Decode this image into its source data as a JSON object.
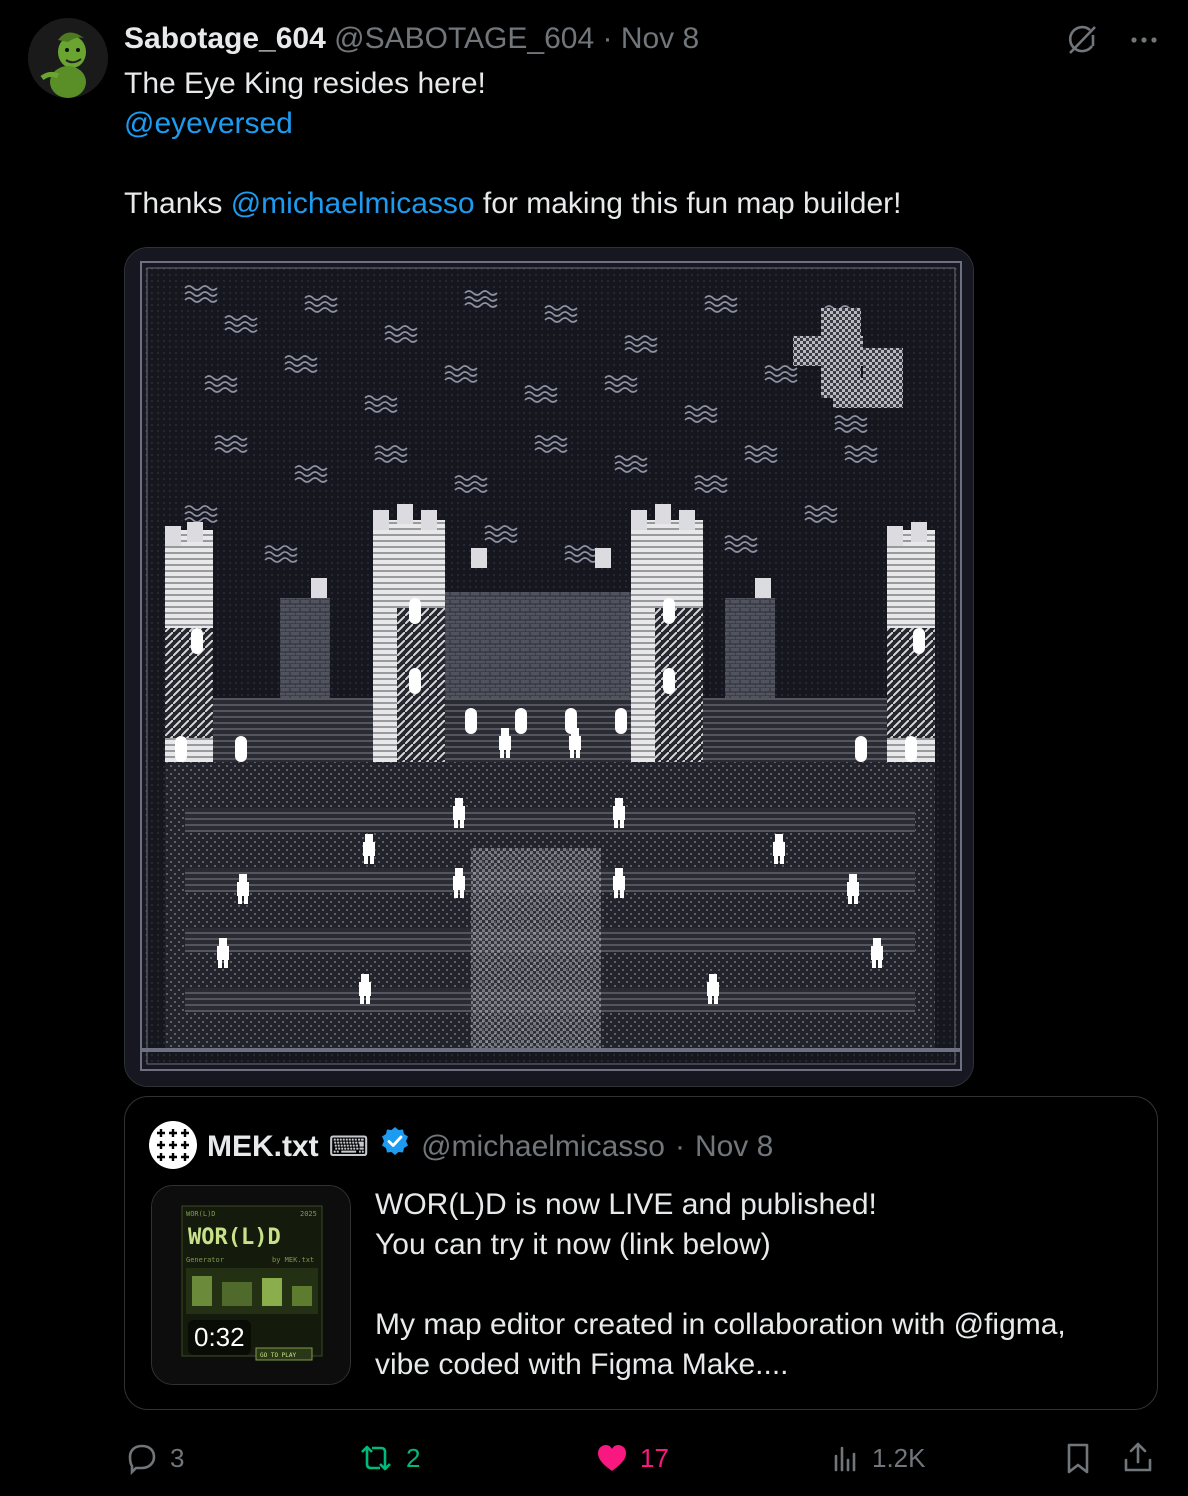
{
  "tweet": {
    "author_name": "Sabotage_604",
    "author_handle": "@SABOTAGE_604",
    "separator": "·",
    "date": "Nov 8",
    "lines": [
      {
        "parts": [
          {
            "text": "The Eye King resides here!",
            "mention": false
          }
        ]
      },
      {
        "parts": [
          {
            "text": "@eyeversed",
            "mention": true
          }
        ]
      },
      {
        "parts": []
      },
      {
        "parts": [
          {
            "text": "Thanks ",
            "mention": false
          },
          {
            "text": "@michaelmicasso",
            "mention": true
          },
          {
            "text": " for making this fun map builder!",
            "mention": false
          }
        ]
      }
    ]
  },
  "quote": {
    "author_name": "MEK.txt",
    "author_emoji": "⌨",
    "author_handle": "@michaelmicasso",
    "separator": "·",
    "date": "Nov 8",
    "video_duration": "0:32",
    "thumbnail": {
      "title": "WOR(L)D",
      "top_left": "WOR(L)D",
      "top_right": "2025",
      "sub_left": "Generator",
      "sub_right": "by MEK.txt",
      "button": "GO TO PLAY"
    },
    "lines": [
      "WOR(L)D is now LIVE and published!",
      "You can try it now (link below)",
      "",
      "My map editor created in collaboration with @figma,",
      "vibe coded with Figma Make...."
    ]
  },
  "actions": {
    "replies": "3",
    "reposts": "2",
    "likes": "17",
    "views": "1.2K"
  },
  "colors": {
    "background": "#000000",
    "text": "#e7e9ea",
    "muted": "#71767b",
    "link": "#1d9bf0",
    "repost": "#00ba7c",
    "like": "#f91880",
    "verified": "#1d9bf0"
  },
  "icons": [
    "grok-icon",
    "more-icon",
    "reply-icon",
    "repost-icon",
    "like-icon",
    "views-icon",
    "bookmark-icon",
    "share-icon",
    "verified-icon"
  ]
}
